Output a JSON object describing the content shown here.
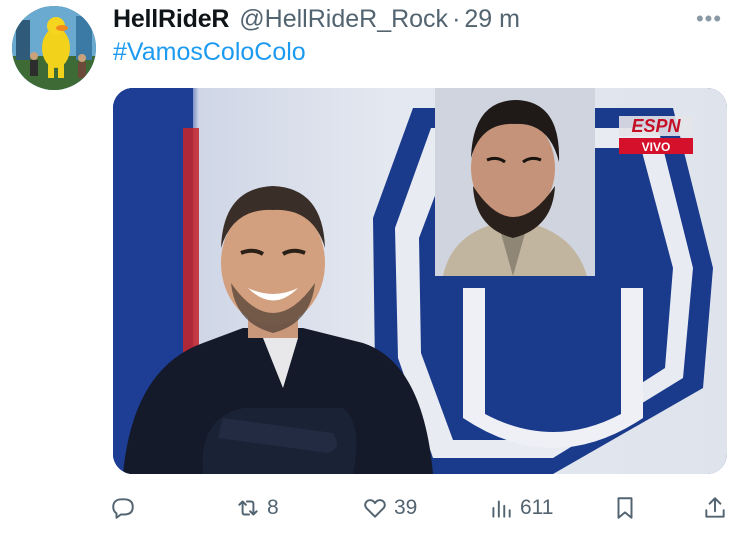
{
  "tweet": {
    "display_name": "HellRideR",
    "handle": "@HellRideR_Rock",
    "separator": "·",
    "time": "29 m",
    "text": "#VamosColoColo",
    "more_label": "•••"
  },
  "media": {
    "broadcaster_logo": "ESPN",
    "live_badge": "VIVO",
    "crest_letter": "U"
  },
  "actions": {
    "reply": {
      "icon": "reply-icon",
      "count": ""
    },
    "retweet": {
      "icon": "retweet-icon",
      "count": "8"
    },
    "like": {
      "icon": "heart-icon",
      "count": "39"
    },
    "views": {
      "icon": "views-icon",
      "count": "611"
    },
    "bookmark": {
      "icon": "bookmark-icon"
    },
    "share": {
      "icon": "share-icon"
    }
  },
  "colors": {
    "link": "#1d9bf0",
    "muted": "#536471",
    "text": "#0f1419",
    "espn_red": "#d4102a",
    "crest_blue": "#1a3a8c"
  }
}
